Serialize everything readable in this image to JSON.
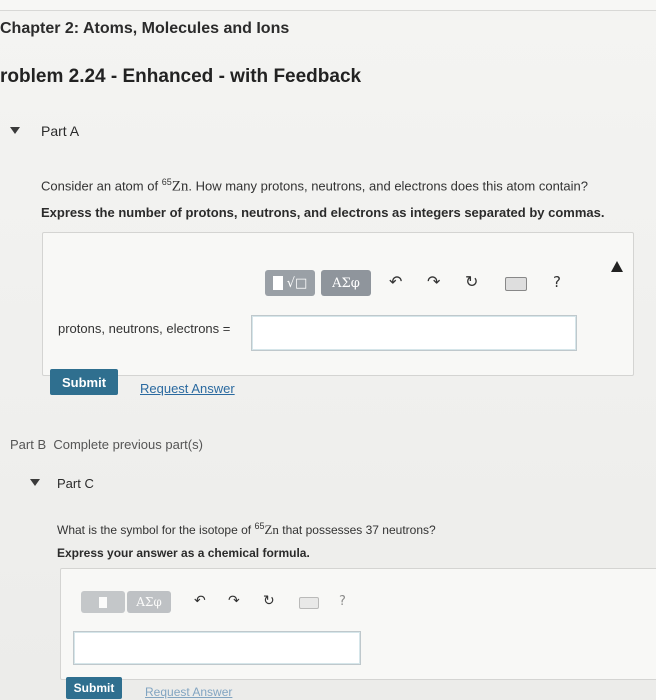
{
  "header": {
    "chapter": "Chapter 2: Atoms, Molecules and Ions",
    "problem": "roblem 2.24 - Enhanced - with Feedback"
  },
  "partA": {
    "title": "Part A",
    "question_pre": "Consider an atom of ",
    "mass_number": "65",
    "element": "Zn",
    "question_post": ". How many protons, neutrons, and electrons does this atom contain?",
    "instruction": "Express the number of protons, neutrons, and electrons as integers separated by commas.",
    "toolbar": {
      "greek": "ΑΣφ",
      "help": "?"
    },
    "input_label": "protons, neutrons, electrons =",
    "input_value": "",
    "submit": "Submit",
    "request": "Request Answer"
  },
  "partB": {
    "title": "Part B",
    "status": "Complete previous part(s)"
  },
  "partC": {
    "title": "Part C",
    "question_pre": "What is the symbol for the isotope of ",
    "mass_number": "65",
    "element": "Zn",
    "question_post": " that possesses 37 neutrons?",
    "instruction": "Express your answer as a chemical formula.",
    "toolbar": {
      "greek": "ΑΣφ",
      "help": "?"
    },
    "input_value": "",
    "submit": "Submit",
    "request": "Request Answer"
  }
}
